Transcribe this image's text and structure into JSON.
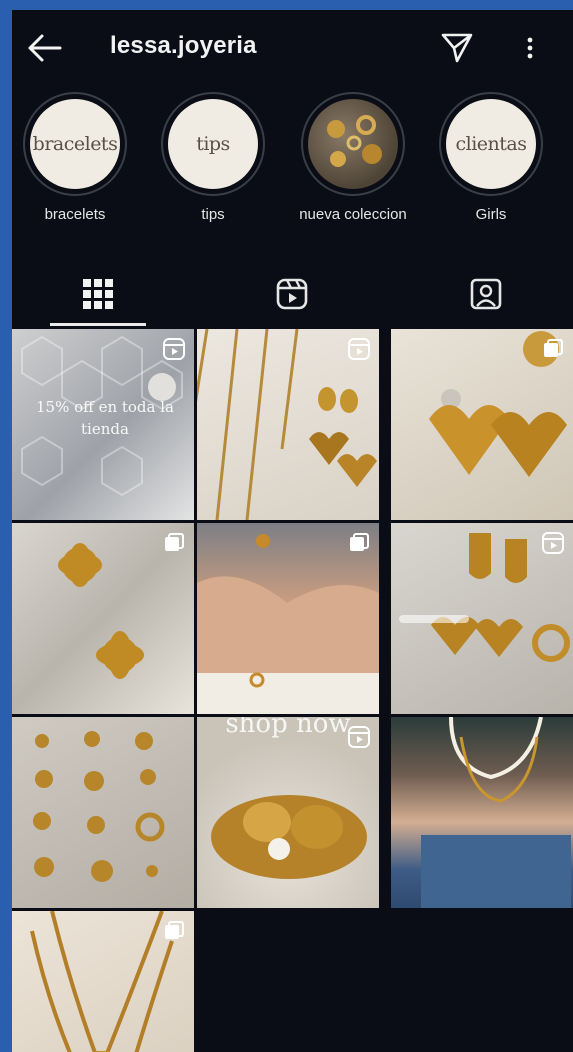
{
  "header": {
    "username": "lessa.joyeria",
    "icons": [
      "back-arrow-icon",
      "send-icon",
      "more-options-icon"
    ]
  },
  "highlights": [
    {
      "label": "bracelets",
      "cover_text": "bracelets"
    },
    {
      "label": "tips",
      "cover_text": "tips"
    },
    {
      "label": "nueva coleccion",
      "cover_text": ""
    },
    {
      "label": "Girls",
      "cover_text": "clientas"
    }
  ],
  "tabs": [
    {
      "name": "posts",
      "icon": "grid-icon",
      "active": true
    },
    {
      "name": "reels",
      "icon": "reels-icon",
      "active": false
    },
    {
      "name": "tagged",
      "icon": "tagged-icon",
      "active": false
    }
  ],
  "posts": [
    {
      "type": "reel",
      "overlay": "15% off en toda la tienda"
    },
    {
      "type": "reel",
      "overlay": ""
    },
    {
      "type": "carousel",
      "overlay": ""
    },
    {
      "type": "carousel",
      "overlay": ""
    },
    {
      "type": "carousel",
      "overlay": ""
    },
    {
      "type": "reel",
      "overlay": ""
    },
    {
      "type": "photo",
      "overlay": ""
    },
    {
      "type": "reel",
      "overlay": "shop now"
    },
    {
      "type": "photo",
      "overlay": ""
    },
    {
      "type": "carousel",
      "overlay": ""
    }
  ],
  "colors": {
    "background": "#0a0d16",
    "text": "#f2f2f2",
    "accent_frame": "#2a5fb0"
  }
}
